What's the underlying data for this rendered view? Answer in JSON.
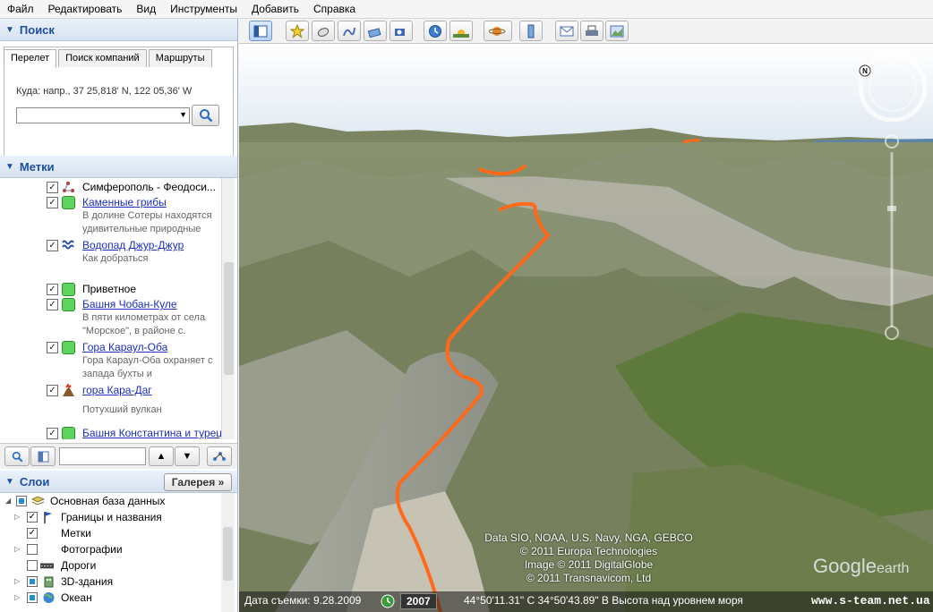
{
  "menu": [
    "Файл",
    "Редактировать",
    "Вид",
    "Инструменты",
    "Добавить",
    "Справка"
  ],
  "search": {
    "header": "Поиск",
    "tabs": [
      "Перелет",
      "Поиск компаний",
      "Маршруты"
    ],
    "dest_label": "Куда:",
    "dest_hint": "напр., 37 25,818' N, 122 05,36' W",
    "input_value": ""
  },
  "places": {
    "header": "Метки",
    "items": [
      {
        "label": "Симферополь - Феодоси...",
        "desc": "",
        "link": false,
        "checked": true,
        "icon": "path-icon"
      },
      {
        "label": "Каменные грибы",
        "desc1": "В долине Сотеры находятся",
        "desc2": "удивительные природные",
        "link": true,
        "checked": true,
        "icon": "placemark-green-icon"
      },
      {
        "label": "Водопад Джур-Джур",
        "desc1": "Как добраться",
        "desc2": "",
        "link": true,
        "checked": true,
        "icon": "waterfall-icon"
      },
      {
        "label": "Приветное",
        "desc1": "",
        "desc2": "",
        "link": false,
        "checked": true,
        "icon": "placemark-green-icon"
      },
      {
        "label": "Башня Чобан-Куле",
        "desc1": "В пяти километрах от села",
        "desc2": "\"Морское\", в районе с.",
        "link": true,
        "checked": true,
        "icon": "placemark-green-icon"
      },
      {
        "label": "Гора Караул-Оба",
        "desc1": "Гора Караул-Оба охраняет с",
        "desc2": "запада бухты и",
        "link": true,
        "checked": true,
        "icon": "placemark-green-icon"
      },
      {
        "label": "гора Кара-Даг",
        "desc1": "",
        "desc2": "Потухший вулкан",
        "link": true,
        "checked": true,
        "icon": "volcano-icon"
      },
      {
        "label": "Башня Константина и турец",
        "desc1": "",
        "desc2": "",
        "link": true,
        "checked": true,
        "icon": "placemark-green-icon"
      }
    ]
  },
  "layers": {
    "header": "Слои",
    "gallery": "Галерея",
    "items": [
      {
        "label": "Основная база данных",
        "level": 0
      },
      {
        "label": "Границы и названия",
        "level": 1
      },
      {
        "label": "Метки",
        "level": 1
      },
      {
        "label": "Фотографии",
        "level": 1
      },
      {
        "label": "Дороги",
        "level": 1
      },
      {
        "label": "3D-здания",
        "level": 1
      },
      {
        "label": "Океан",
        "level": 1
      }
    ]
  },
  "map": {
    "attribution": [
      "Data SIO, NOAA, U.S. Navy, NGA, GEBCO",
      "© 2011 Europa Technologies",
      "Image © 2011 DigitalGlobe",
      "© 2011 Transnavicom, Ltd"
    ],
    "logo": "Google",
    "logo_suffix": "earth"
  },
  "status": {
    "date_label": "Дата съемки: 9.28.2009",
    "year": "2007",
    "coords": "44°50'11.31\" С  34°50'43.89\" В Высота над уровнем моря",
    "watermark": "www.s-team.net.ua"
  },
  "colors": {
    "track": "#ff6a1a",
    "link": "#1c2fb8",
    "header_text": "#1c4f9c"
  }
}
